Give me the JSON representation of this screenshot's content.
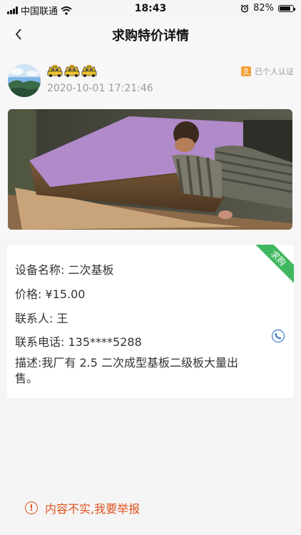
{
  "status": {
    "carrier": "中国联通",
    "time": "18:43",
    "battery": "82%",
    "battery_level": 0.82
  },
  "nav": {
    "title": "求购特价详情",
    "back_icon": "chevron-left-icon"
  },
  "user": {
    "badge_icons": [
      "taxi-icon",
      "taxi-icon",
      "taxi-icon"
    ],
    "post_time": "2020-10-01 17:21:46",
    "verified_label": "已个人认证"
  },
  "listing": {
    "tag": "求购",
    "name_label": "设备名称:",
    "name_value": "二次基板",
    "price_label": "价格:",
    "price_value": "¥15.00",
    "contact_label": "联系人:",
    "contact_value": "王",
    "phone_label": "联系电话:",
    "phone_value": "135****5288",
    "desc_label": "描述:",
    "desc_value": "我厂有 2.5 二次成型基板二级板大量出售。"
  },
  "report": {
    "label": "内容不实,我要举报"
  },
  "colors": {
    "accent_orange": "#e0531f",
    "ribbon_green": "#3fb85f",
    "cert_orange": "#f5a23a"
  }
}
